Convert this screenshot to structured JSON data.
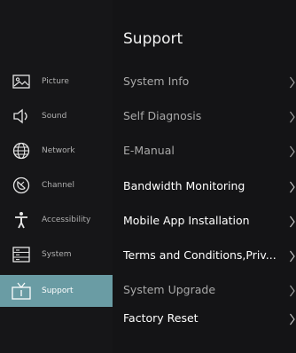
{
  "sidebar": {
    "items": [
      {
        "label": "Picture",
        "icon": "picture-icon",
        "active": false
      },
      {
        "label": "Sound",
        "icon": "speaker-icon",
        "active": false
      },
      {
        "label": "Network",
        "icon": "globe-icon",
        "active": false
      },
      {
        "label": "Channel",
        "icon": "satellite-dish-icon",
        "active": false
      },
      {
        "label": "Accessibility",
        "icon": "accessibility-person-icon",
        "active": false
      },
      {
        "label": "System",
        "icon": "system-list-icon",
        "active": false
      },
      {
        "label": "Support",
        "icon": "tv-support-icon",
        "active": true
      }
    ]
  },
  "main": {
    "title": "Support",
    "items": [
      {
        "label": "System Info"
      },
      {
        "label": "Self Diagnosis"
      },
      {
        "label": "E-Manual"
      },
      {
        "label": "Bandwidth Monitoring"
      },
      {
        "label": "Mobile App Installation"
      },
      {
        "label": "Terms and Conditions,Priv..."
      },
      {
        "label": "System Upgrade"
      },
      {
        "label": "Factory Reset"
      }
    ]
  },
  "colors": {
    "background": "#0c0c0e",
    "sidebar": "#161618",
    "panel": "#141416",
    "active_highlight": "#6a9ca4"
  }
}
